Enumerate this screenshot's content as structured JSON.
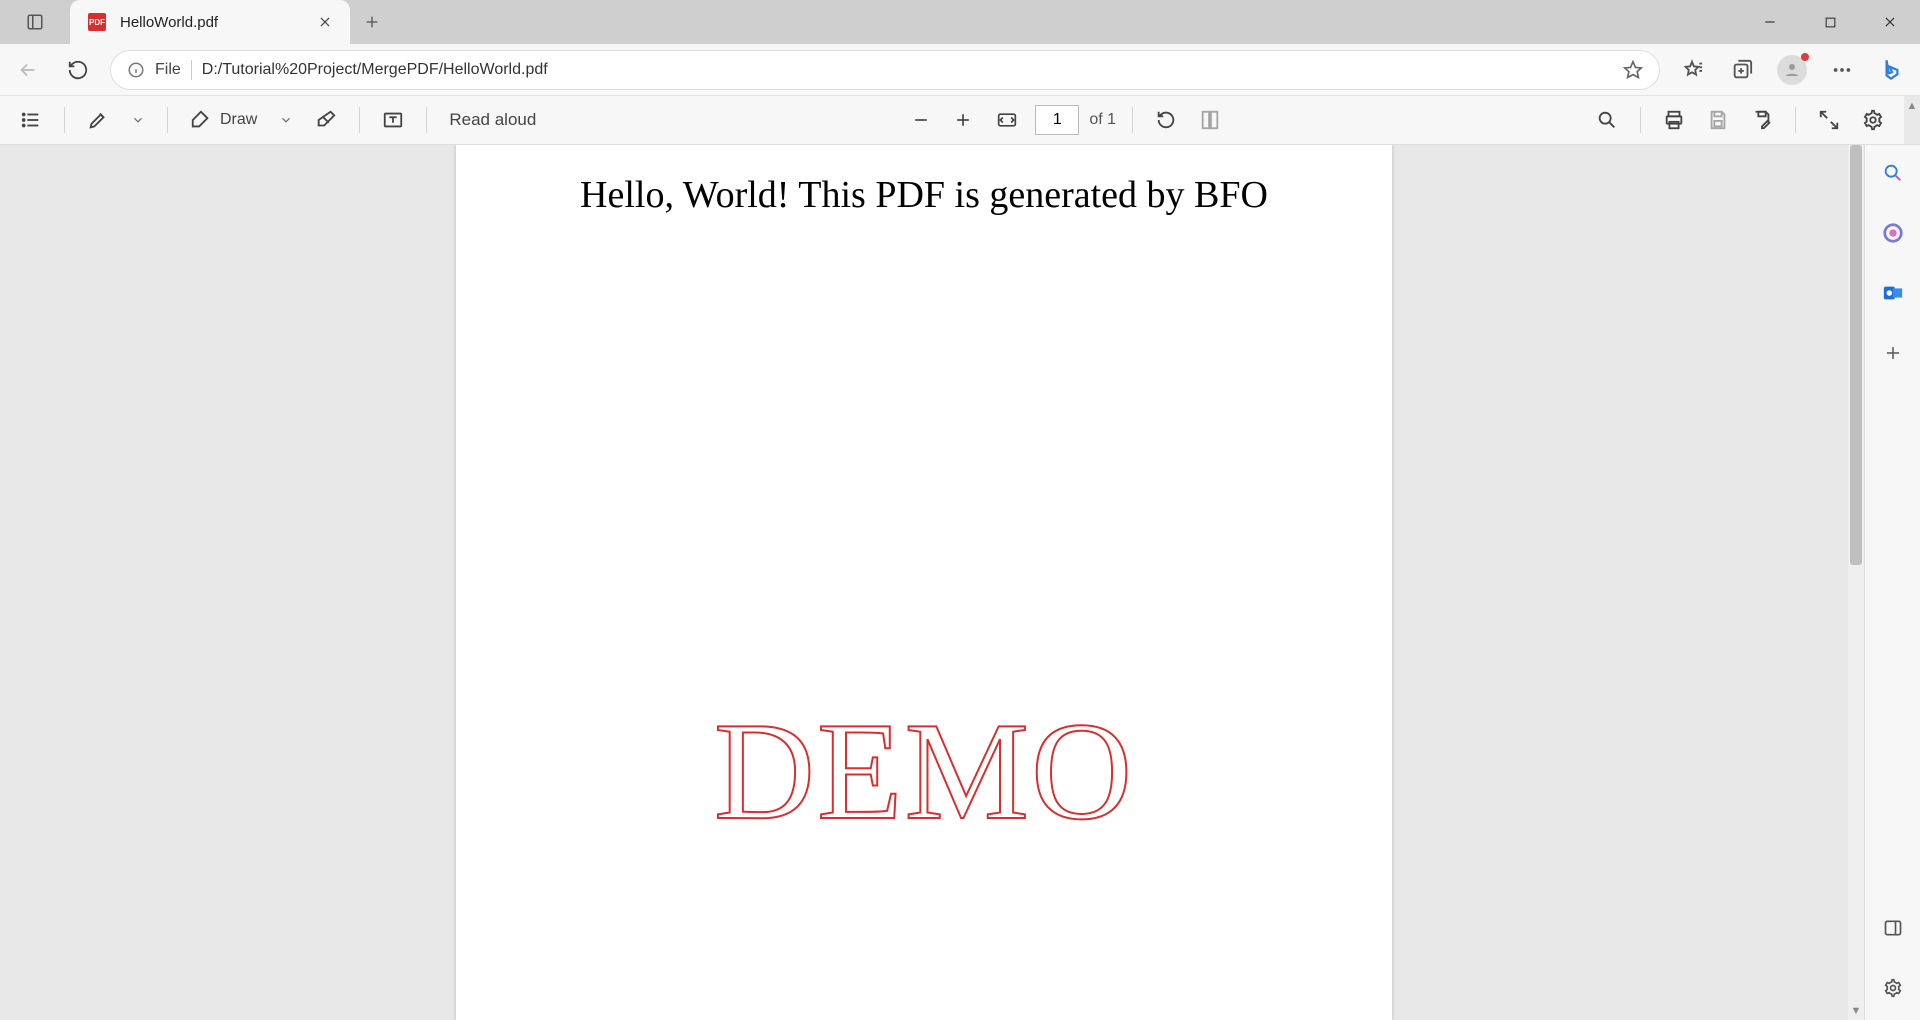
{
  "tab": {
    "title": "HelloWorld.pdf",
    "badge": "PDF"
  },
  "address": {
    "scheme_label": "File",
    "path": "D:/Tutorial%20Project/MergePDF/HelloWorld.pdf"
  },
  "pdf_toolbar": {
    "draw_label": "Draw",
    "read_aloud_label": "Read aloud",
    "page_current": "1",
    "page_of": "of 1"
  },
  "document": {
    "heading": "Hello, World! This PDF is generated by BFO",
    "watermark": "DEMO"
  }
}
